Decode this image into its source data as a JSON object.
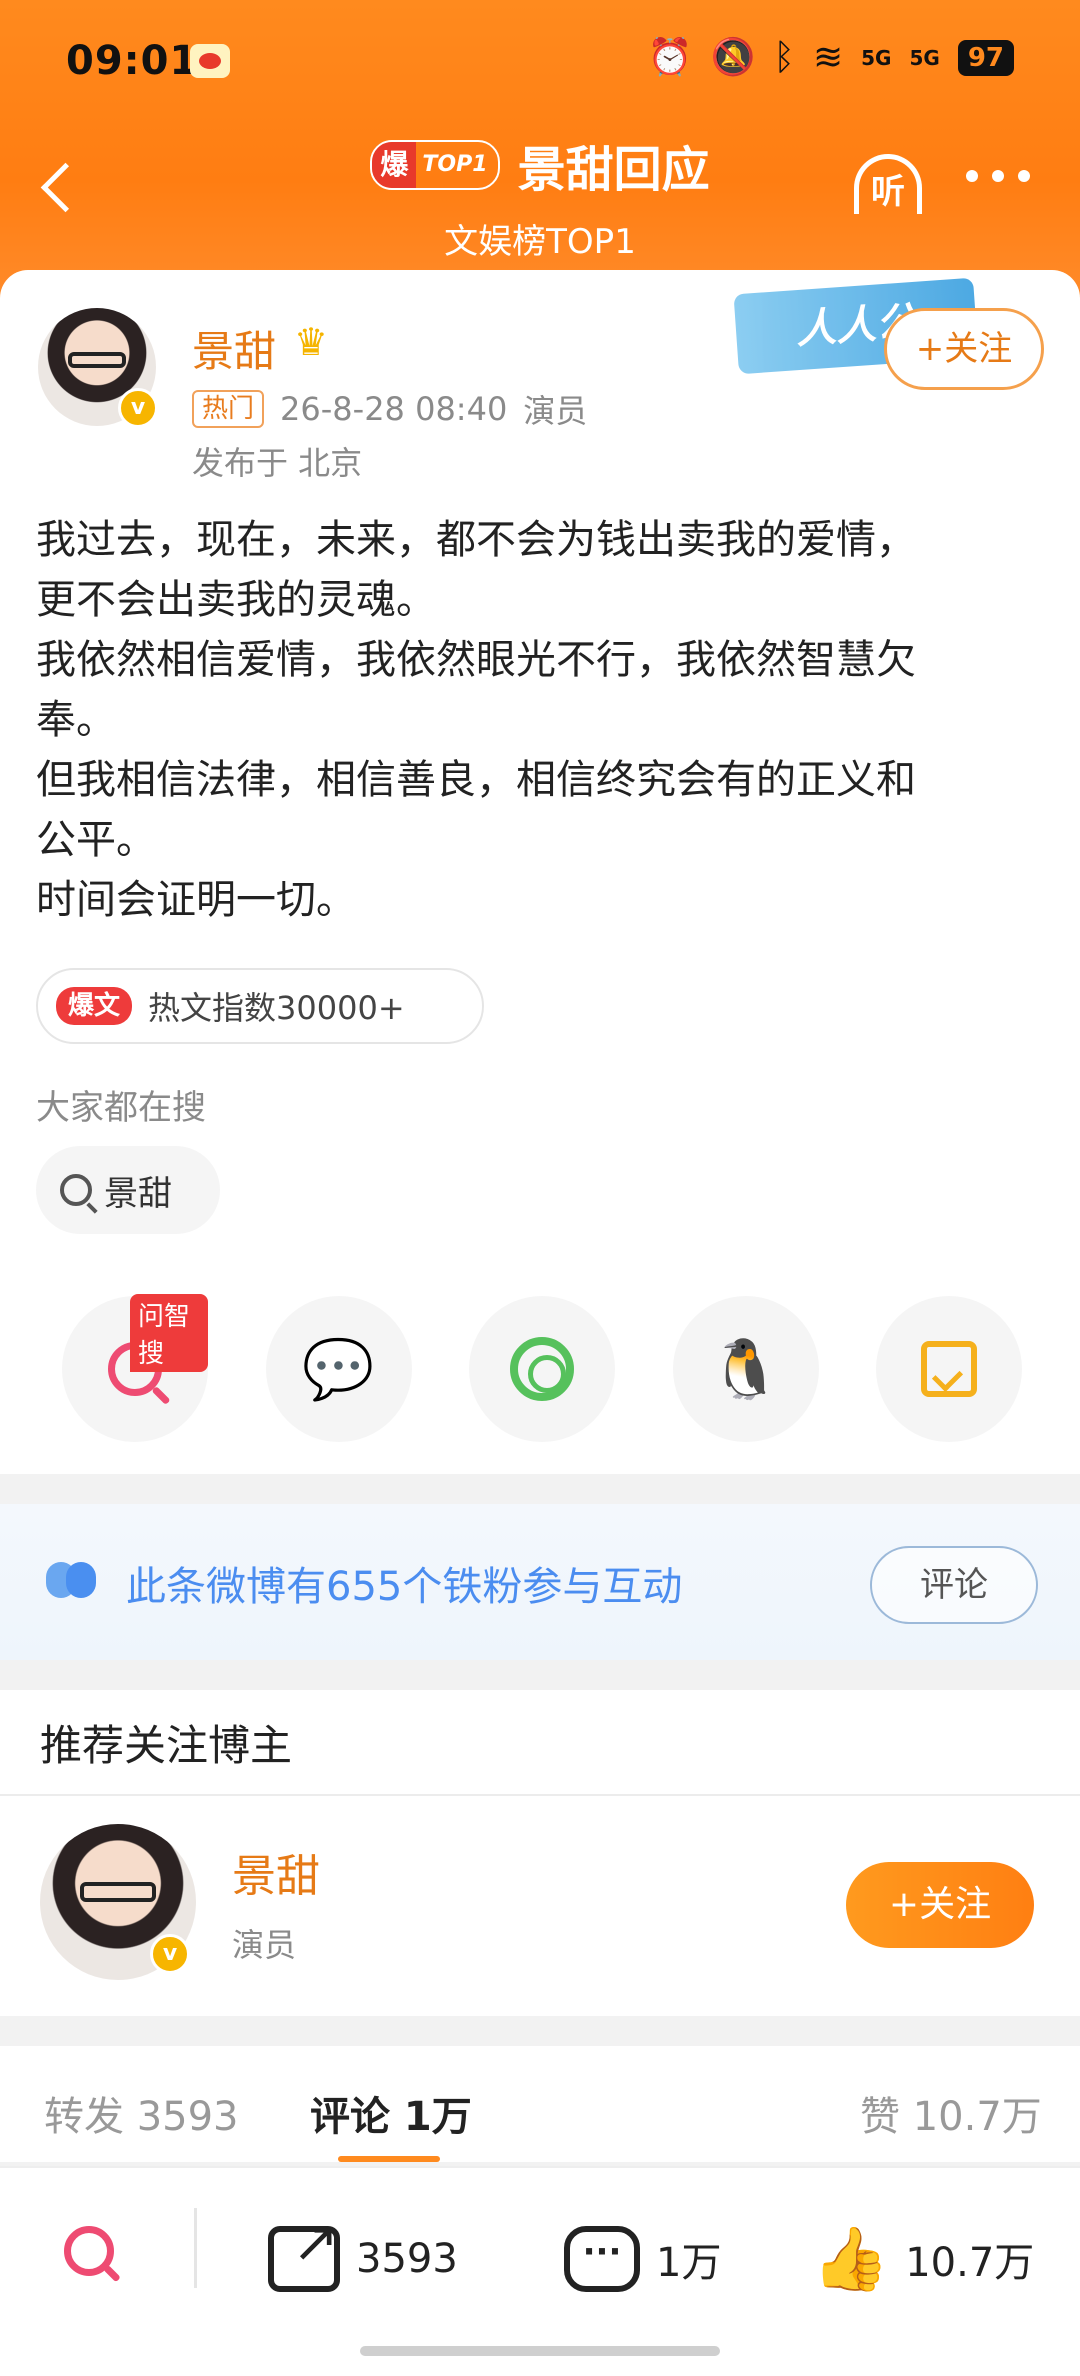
{
  "status_bar": {
    "time": "09:01",
    "signal1": "5G",
    "signal2": "5G",
    "battery": "97"
  },
  "header": {
    "badge_main": "爆",
    "badge_top": "TOP1",
    "title": "景甜回应",
    "subtitle": "文娱榜TOP1",
    "listen_label": "听"
  },
  "post": {
    "author": "景甜",
    "hot_tag": "热门",
    "timestamp": "26-8-28 08:40",
    "role": "演员",
    "location": "发布于 北京",
    "banner": "人人公",
    "follow_label": "+关注",
    "lines": [
      "我过去，现在，未来，都不会为钱出卖我的爱情，",
      "更不会出卖我的灵魂。",
      "我依然相信爱情，我依然眼光不行，我依然智慧欠",
      "奉。",
      "但我相信法律，相信善良，相信终究会有的正义和",
      "公平。",
      "时间会证明一切。"
    ],
    "hot_badge": "爆文",
    "hot_index": "热文指数30000+",
    "search_label": "大家都在搜",
    "search_chip": "景甜",
    "share": {
      "search_tag": "问智搜"
    }
  },
  "fans_banner": {
    "text": "此条微博有655个铁粉参与互动",
    "button": "评论"
  },
  "recommend": {
    "title": "推荐关注博主",
    "name": "景甜",
    "role": "演员",
    "follow_label": "+关注"
  },
  "tabs": {
    "repost": "转发 3593",
    "comment": "评论 1万",
    "like": "赞 10.7万"
  },
  "bottom_bar": {
    "repost_count": "3593",
    "comment_count": "1万",
    "like_count": "10.7万"
  },
  "colors": {
    "brand_orange": "#ff8a1e",
    "name_orange": "#e67a16",
    "hot_red": "#ee3b3b",
    "fans_blue": "#4b8df0"
  }
}
